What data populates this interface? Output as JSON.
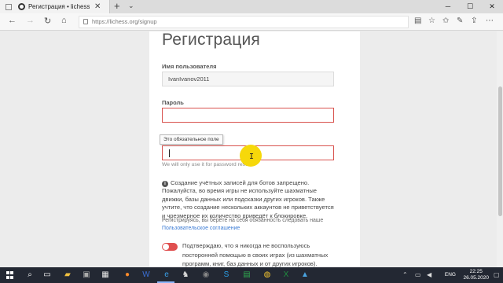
{
  "browser": {
    "tab_title": "Регистрация • lichess.o",
    "tab_close": "✕",
    "new_tab": "+",
    "url": "https://lichess.org/signup"
  },
  "form": {
    "title": "Регистрация",
    "username_label": "Имя пользователя",
    "username_value": "IvanIvanov2011",
    "password_label": "Пароль",
    "password_value": "",
    "email_label": "",
    "email_value": "",
    "tooltip": "Это обязательное поле",
    "email_hint": "We will only use it for password reset.",
    "info_icon": "i",
    "info_text": "Создание учётных записей для ботов запрещено. Пожалуйста, во время игры не используйте шахматные движки, базы данных или подсказки других игроков. Также учтите, что создание нескольких аккаунтов не приветствуется и чрезмерное их количество приведёт к блокировке.",
    "agree_text": "Регистрируясь, вы берёте на себя обязанность следовать наше",
    "agree_link": "Пользовательское соглашение",
    "confirm_text": "Подтверждаю, что я никогда не воспользуюсь посторонней помощью в своих играх (из шахматных программ, книг, баз данных и от других игроков).",
    "confirm_toggle_on": false
  },
  "taskbar": {
    "lang": "ENG",
    "time": "22:25",
    "date": "26.05.2020"
  },
  "icons": [
    "windows-logo",
    "search-icon",
    "task-view-icon",
    "file-explorer-icon",
    "firefox-icon",
    "word-icon",
    "edge-icon",
    "chess-icon",
    "camera-icon",
    "skype-icon",
    "spreadsheet-icon",
    "chrome-icon",
    "excel-icon",
    "photos-icon"
  ]
}
